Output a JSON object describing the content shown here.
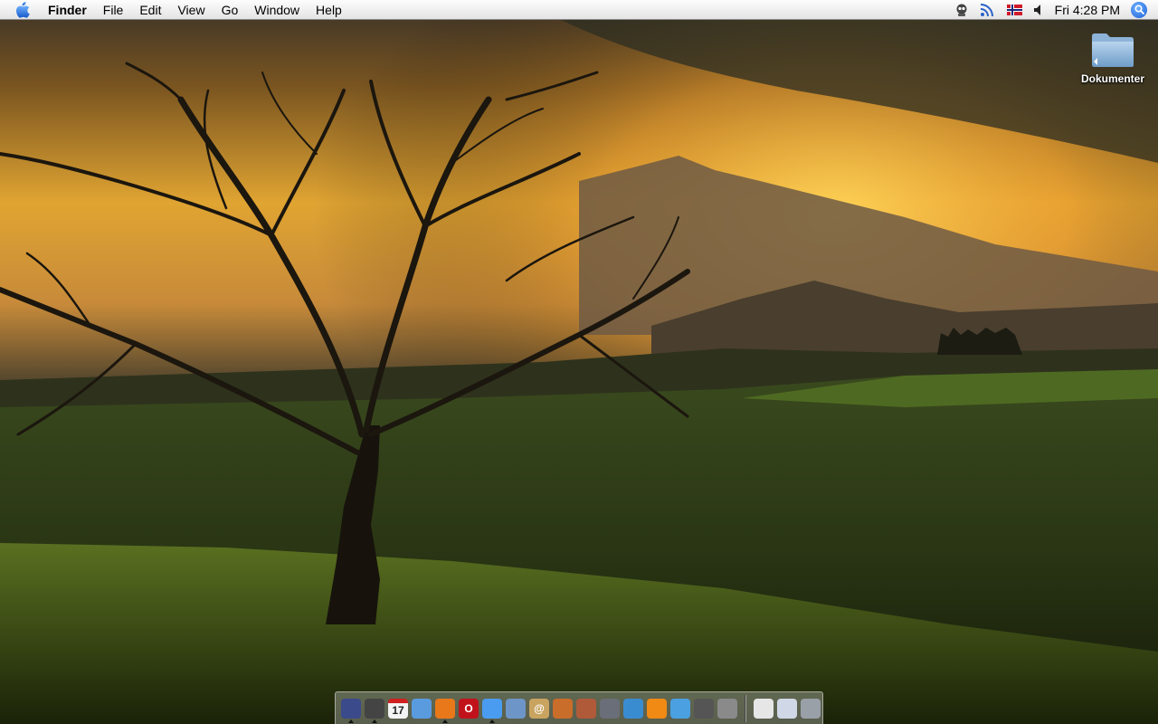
{
  "menubar": {
    "app_name": "Finder",
    "menus": [
      "File",
      "Edit",
      "View",
      "Go",
      "Window",
      "Help"
    ],
    "clock": "Fri 4:28 PM",
    "status_icons": [
      "robot-icon",
      "rss-icon",
      "norwegian-flag-icon",
      "volume-icon"
    ]
  },
  "desktop": {
    "icons": [
      {
        "label": "Dokumenter",
        "icon": "folder-icon"
      }
    ]
  },
  "dock": {
    "apps": [
      {
        "name": "dashboard-icon",
        "color": "#3a4a8a",
        "glyph": "",
        "running": true
      },
      {
        "name": "dashboard-clock-icon",
        "color": "#444444",
        "glyph": "",
        "running": true
      },
      {
        "name": "calendar-icon",
        "color": "#f4f4f4",
        "glyph": "17",
        "running": false
      },
      {
        "name": "safari-icon",
        "color": "#5a9be0",
        "glyph": "",
        "running": false
      },
      {
        "name": "firefox-icon",
        "color": "#e8781a",
        "glyph": "",
        "running": true
      },
      {
        "name": "opera-icon",
        "color": "#c1121b",
        "glyph": "O",
        "running": false
      },
      {
        "name": "ichat-icon",
        "color": "#4a9cf0",
        "glyph": "",
        "running": true
      },
      {
        "name": "mail-icon",
        "color": "#6d95c8",
        "glyph": "",
        "running": false
      },
      {
        "name": "address-book-icon",
        "color": "#c9a460",
        "glyph": "@",
        "running": false
      },
      {
        "name": "iphoto-icon",
        "color": "#c86d2a",
        "glyph": "",
        "running": false
      },
      {
        "name": "preview-icon",
        "color": "#b05a3a",
        "glyph": "",
        "running": false
      },
      {
        "name": "pixel-editor-icon",
        "color": "#6a6e78",
        "glyph": "",
        "running": false
      },
      {
        "name": "numbers-icon",
        "color": "#3a8cd0",
        "glyph": "",
        "running": false
      },
      {
        "name": "vlc-icon",
        "color": "#f08a14",
        "glyph": "",
        "running": false
      },
      {
        "name": "itunes-icon",
        "color": "#4aa0e0",
        "glyph": "",
        "running": false
      },
      {
        "name": "utilities-icon",
        "color": "#555555",
        "glyph": "",
        "running": false
      },
      {
        "name": "system-preferences-icon",
        "color": "#8a8a8a",
        "glyph": "",
        "running": false
      }
    ],
    "docs": [
      {
        "name": "stack-folder-icon",
        "color": "#e6e6e6",
        "glyph": ""
      },
      {
        "name": "text-document-icon",
        "color": "#d0d8e8",
        "glyph": ""
      },
      {
        "name": "trash-icon",
        "color": "#9aa0a8",
        "glyph": ""
      }
    ]
  }
}
